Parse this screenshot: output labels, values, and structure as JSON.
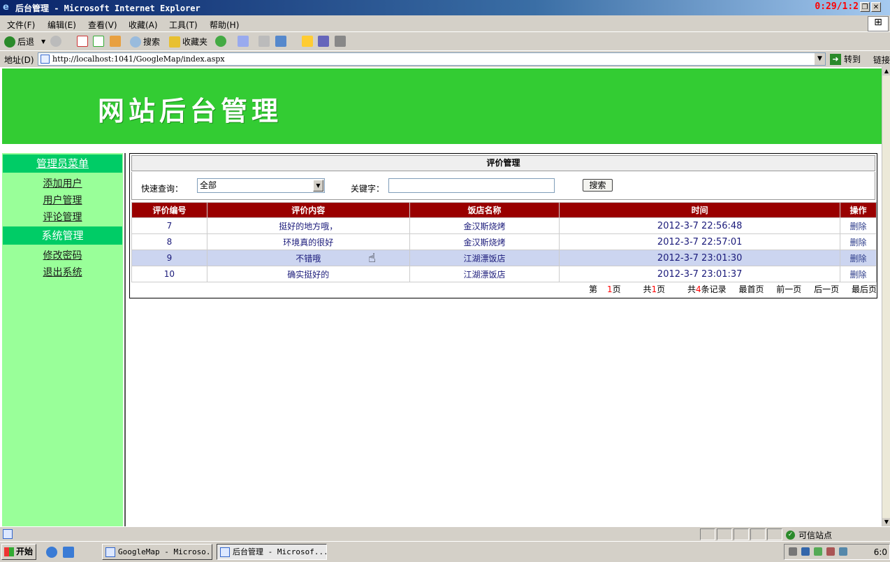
{
  "window": {
    "title": "后台管理 - Microsoft Internet Explorer",
    "clock_overlay": "0:29/1:2"
  },
  "menu": [
    "文件(F)",
    "编辑(E)",
    "查看(V)",
    "收藏(A)",
    "工具(T)",
    "帮助(H)"
  ],
  "toolbar": {
    "back": "后退",
    "search": "搜索",
    "favorites": "收藏夹"
  },
  "address": {
    "label": "地址(D)",
    "url": "http://localhost:1041/GoogleMap/index.aspx",
    "go": "转到",
    "links": "链接"
  },
  "banner": {
    "title": "网站后台管理"
  },
  "sidebar": {
    "admin_menu_header": "管理员菜单",
    "admin_links": [
      "添加用户",
      "用户管理",
      "评论管理"
    ],
    "system_header": "系统管理",
    "system_links": [
      "修改密码",
      "退出系统"
    ]
  },
  "panel": {
    "title": "评价管理",
    "quick_query_label": "快速查询：",
    "select_value": "全部",
    "keyword_label": "关键字：",
    "keyword_value": "",
    "search_button": "搜索"
  },
  "table": {
    "headers": [
      "评价编号",
      "评价内容",
      "饭店名称",
      "时间",
      "操作"
    ],
    "rows": [
      {
        "id": "7",
        "content": "挺好的地方哦，",
        "restaurant": "金汉斯烧烤",
        "time": "2012-3-7 22:56:48",
        "action": "删除"
      },
      {
        "id": "8",
        "content": "环境真的很好",
        "restaurant": "金汉斯烧烤",
        "time": "2012-3-7 22:57:01",
        "action": "删除"
      },
      {
        "id": "9",
        "content": "不错哦",
        "restaurant": "江湖漂饭店",
        "time": "2012-3-7 23:01:30",
        "action": "删除"
      },
      {
        "id": "10",
        "content": "确实挺好的",
        "restaurant": "江湖漂饭店",
        "time": "2012-3-7 23:01:37",
        "action": "删除"
      }
    ],
    "selected_row": 2
  },
  "pager": {
    "page_prefix": "第",
    "page_num": "1",
    "page_suffix": "页",
    "total_prefix": "共",
    "total_pages": "1",
    "total_pages_suffix": "页",
    "records_prefix": "共",
    "records": "4",
    "records_suffix": "条记录",
    "first": "最首页",
    "prev": "前一页",
    "next": "后一页",
    "last": "最后页"
  },
  "status": {
    "zone": "可信站点"
  },
  "taskbar": {
    "start": "开始",
    "tasks": [
      "GoogleMap - Microso...",
      "后台管理 - Microsof..."
    ],
    "time": "6:0"
  },
  "colors": {
    "banner": "#33cc33",
    "sidebar": "#99ff99",
    "sidebar_header": "#00cc66",
    "table_header": "#990000",
    "selected_row": "#ccd5f0"
  }
}
